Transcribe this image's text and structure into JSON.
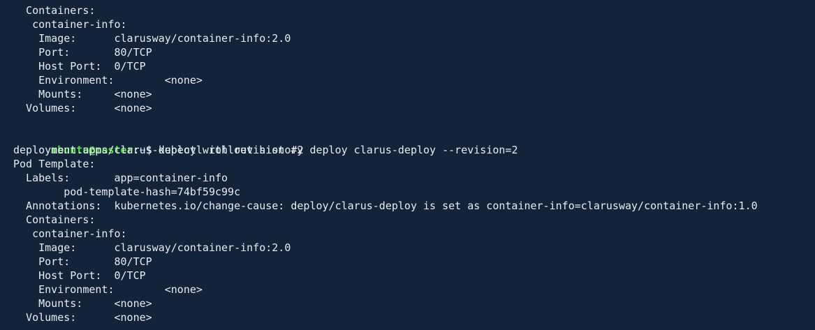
{
  "block1": {
    "lines": [
      "  Containers:",
      "   container-info:",
      "    Image:      clarusway/container-info:2.0",
      "    Port:       80/TCP",
      "    Host Port:  0/TCP",
      "    Environment:        <none>",
      "    Mounts:     <none>",
      "  Volumes:      <none>",
      ""
    ]
  },
  "prompt": {
    "user_host": "ubuntu@master",
    "separator": ":",
    "path": "~",
    "symbol": "$ ",
    "command": "kubectl rollout history deploy clarus-deploy --revision=2"
  },
  "block2": {
    "lines": [
      "deployment.apps/clarus-deploy with revision #2",
      "Pod Template:",
      "  Labels:       app=container-info",
      "        pod-template-hash=74bf59c99c",
      "  Annotations:  kubernetes.io/change-cause: deploy/clarus-deploy is set as container-info=clarusway/container-info:1.0",
      "  Containers:",
      "   container-info:",
      "    Image:      clarusway/container-info:2.0",
      "    Port:       80/TCP",
      "    Host Port:  0/TCP",
      "    Environment:        <none>",
      "    Mounts:     <none>",
      "  Volumes:      <none>"
    ]
  },
  "colors": {
    "background": "#12233a",
    "foreground": "#e8ecf1",
    "prompt_user": "#4ee04a",
    "prompt_path": "#5aa7f5"
  }
}
